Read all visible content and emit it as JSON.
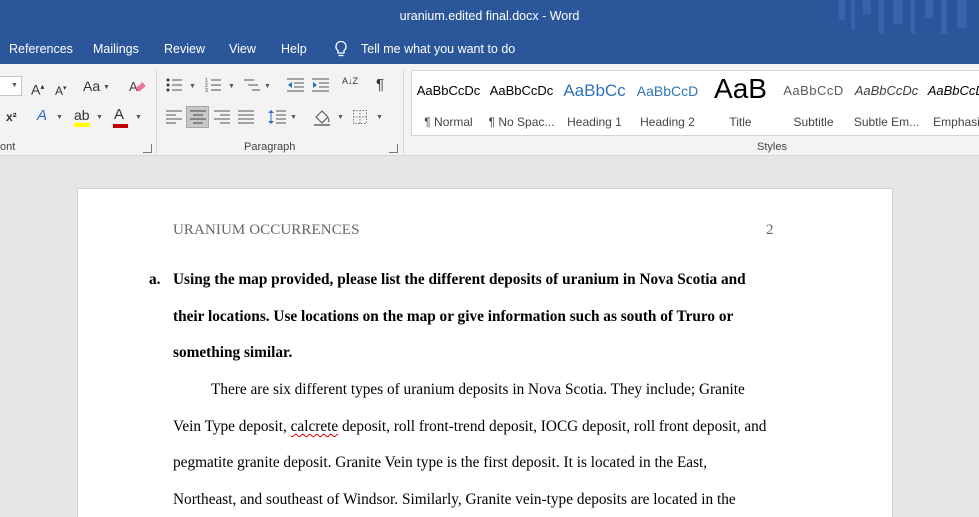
{
  "window": {
    "title": "uranium.edited final.docx  -  Word"
  },
  "menu": {
    "tabs": [
      "References",
      "Mailings",
      "Review",
      "View",
      "Help"
    ],
    "tell_me": "Tell me what you want to do"
  },
  "ribbon": {
    "groups": {
      "font_label": "ont",
      "paragraph_label": "Paragraph",
      "styles_label": "Styles"
    },
    "font": {
      "grow_glyph": "A",
      "shrink_glyph": "A",
      "case_glyph": "Aa",
      "superscript_glyph": "x²",
      "effects_glyph": "A",
      "font_color_glyph": "A",
      "font_color": "#c00000",
      "highlight_color": "#ffff00"
    },
    "paragraph": {
      "sort_glyph": "A↓Z",
      "show_marks_glyph": "¶"
    },
    "styles": [
      {
        "sample": "AaBbCcDc",
        "name": "¶ Normal"
      },
      {
        "sample": "AaBbCcDc",
        "name": "¶ No Spac..."
      },
      {
        "sample": "AaBbCc",
        "name": "Heading 1"
      },
      {
        "sample": "AaBbCcD",
        "name": "Heading 2"
      },
      {
        "sample": "AaB",
        "name": "Title"
      },
      {
        "sample": "AaBbCcD",
        "name": "Subtitle"
      },
      {
        "sample": "AaBbCcDc",
        "name": "Subtle Em..."
      },
      {
        "sample": "AaBbCcDc",
        "name": "Emphasis"
      }
    ]
  },
  "document": {
    "header": "URANIUM OCCURRENCES",
    "page_number": "2",
    "question": {
      "marker": "a.",
      "lines": [
        "Using the map provided, please list the different deposits of uranium in Nova Scotia and",
        "their locations. Use locations on the map or give information such as south of Truro or",
        "something similar."
      ]
    },
    "paragraph": {
      "line1": "There are six different types of uranium deposits in Nova Scotia. They include; Granite",
      "line2_before": "Vein Type deposit, ",
      "line2_misspelled": "calcrete",
      "line2_after": " deposit, roll front-trend deposit, IOCG deposit, roll front deposit, and",
      "line3": "pegmatite granite deposit. Granite Vein type is the first deposit. It is located in the East,",
      "line4": "Northeast, and southeast of Windsor. Similarly, Granite vein-type deposits are located in the"
    }
  }
}
